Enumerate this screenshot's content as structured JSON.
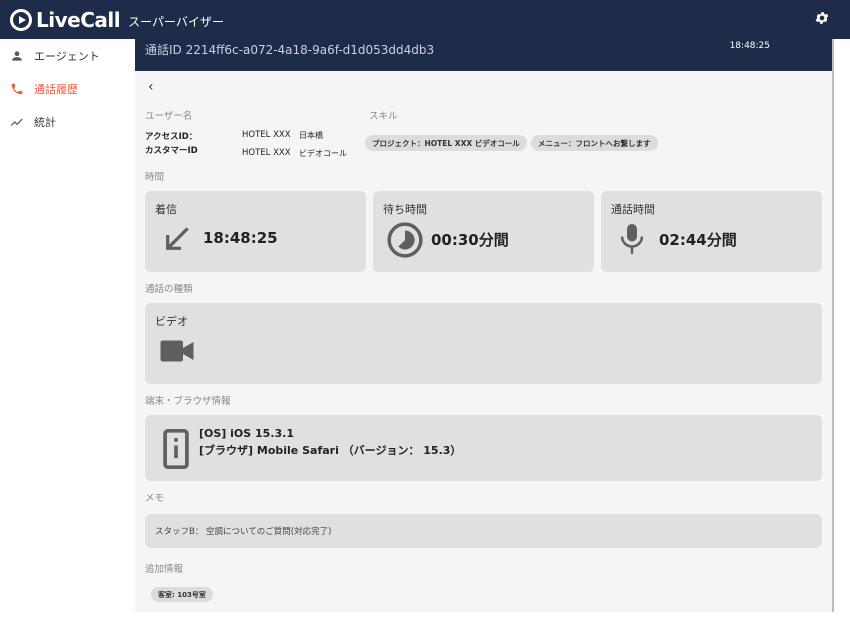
{
  "app": {
    "brand": "LiveCall",
    "subtitle": "スーパーバイザー"
  },
  "sidebar": {
    "items": [
      {
        "label": "エージェント",
        "icon": "person-icon",
        "active": false
      },
      {
        "label": "通話履歴",
        "icon": "phone-icon",
        "active": true
      },
      {
        "label": "統計",
        "icon": "trending-up-icon",
        "active": false
      }
    ]
  },
  "call": {
    "id_text": "通話ID 2214ff6c-a072-4a18-9a6f-d1d053dd4db3",
    "time": "18:48:25"
  },
  "user": {
    "section_label": "ユーザー名",
    "access_id_label": "アクセスID：",
    "customer_id_label": "カスタマーID",
    "access_id_hotel": "HOTEL XXX",
    "access_id_place": "日本橋",
    "customer_id_hotel": "HOTEL XXX",
    "customer_id_place": "ビデオコール"
  },
  "skills": {
    "section_label": "スキル",
    "chips": [
      "プロジェクト：HOTEL XXX ビデオコール",
      "メニュー：フロントへお繋します"
    ]
  },
  "time_section": {
    "label": "時間",
    "incoming": {
      "title": "着信",
      "value": "18:48:25"
    },
    "wait": {
      "title": "待ち時間",
      "value": "00:30分間"
    },
    "talk": {
      "title": "通話時間",
      "value": "02:44分間"
    }
  },
  "call_type": {
    "section_label": "通話の種類",
    "title": "ビデオ"
  },
  "device": {
    "section_label": "端末・ブラウザ情報",
    "os": "[OS] iOS 15.3.1",
    "browser": "[ブラウザ] Mobile Safari （バージョン： 15.3）"
  },
  "memo": {
    "section_label": "メモ",
    "text": "スタッフB： 空調についてのご質問(対応完了)"
  },
  "extra": {
    "section_label": "追加情報",
    "chip": "客室: 103号室"
  },
  "colors": {
    "navy": "#1e2c4a",
    "accent": "#e85a3c",
    "card": "#e0e0e0"
  }
}
